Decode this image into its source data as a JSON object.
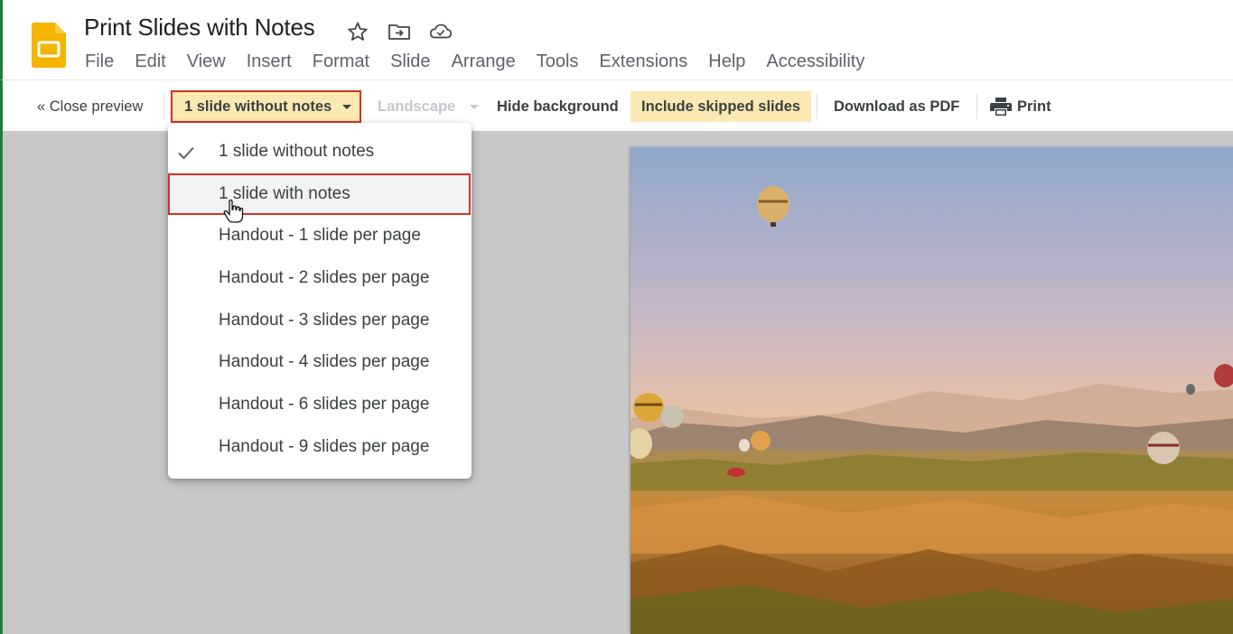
{
  "document": {
    "title": "Print Slides with Notes"
  },
  "title_icons": [
    "star-icon",
    "move-to-folder-icon",
    "cloud-saved-icon"
  ],
  "menu": [
    "File",
    "Edit",
    "View",
    "Insert",
    "Format",
    "Slide",
    "Arrange",
    "Tools",
    "Extensions",
    "Help",
    "Accessibility"
  ],
  "toolbar": {
    "close_preview": "« Close preview",
    "layout_selected": "1 slide without notes",
    "orientation": "Landscape",
    "hide_background": "Hide background",
    "include_skipped": "Include skipped slides",
    "download_pdf": "Download as PDF",
    "print": "Print"
  },
  "dropdown": {
    "items": [
      {
        "label": "1 slide without notes",
        "checked": true
      },
      {
        "label": "1 slide with notes",
        "checked": false,
        "hovered": true
      },
      {
        "label": "Handout - 1 slide per page",
        "checked": false
      },
      {
        "label": "Handout - 2 slides per page",
        "checked": false
      },
      {
        "label": "Handout - 3 slides per page",
        "checked": false
      },
      {
        "label": "Handout - 4 slides per page",
        "checked": false
      },
      {
        "label": "Handout - 6 slides per page",
        "checked": false
      },
      {
        "label": "Handout - 9 slides per page",
        "checked": false
      }
    ]
  },
  "colors": {
    "accent_highlight": "#fce8b2",
    "annotation_red": "#d93025",
    "canvas_gray": "#c8c8c8",
    "logo_yellow": "#f4b400"
  }
}
